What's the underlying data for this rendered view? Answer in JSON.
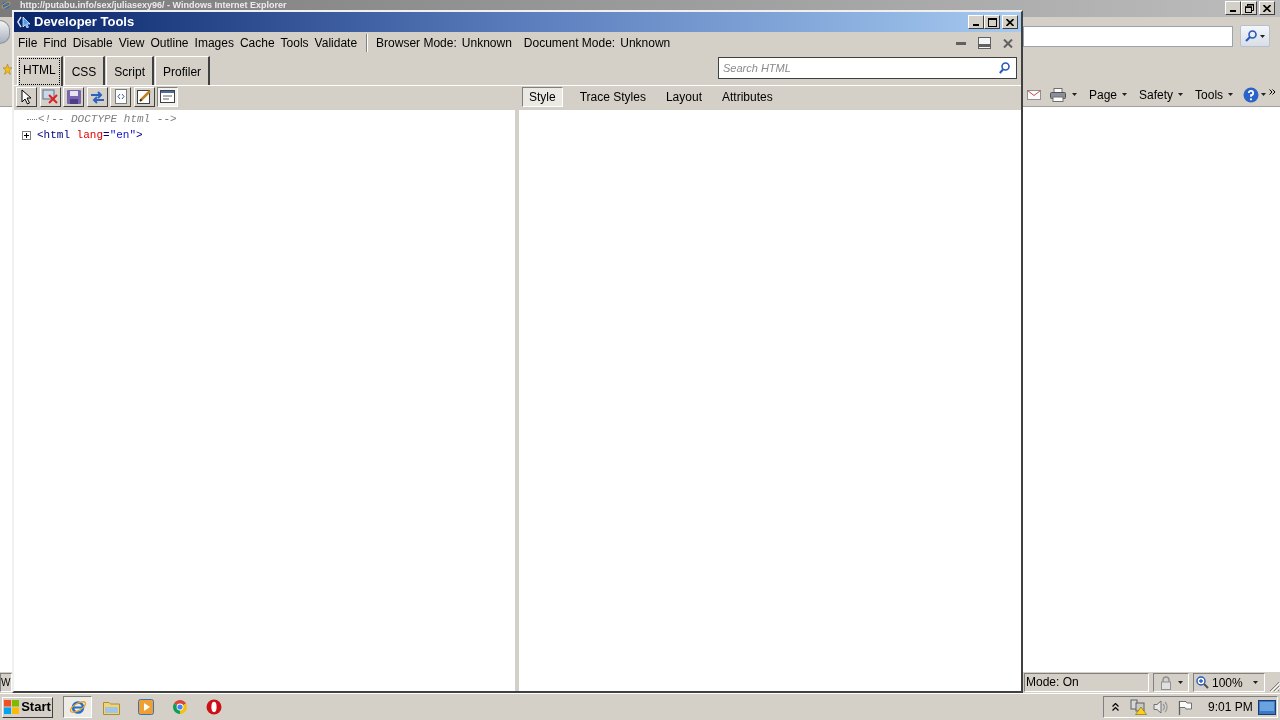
{
  "browser": {
    "title": "http://putabu.info/sex/juliasexy96/ - Windows Internet Explorer",
    "command_menus": [
      "Page",
      "Safety",
      "Tools"
    ],
    "status_bar": {
      "text": "W",
      "mode": "Mode: On",
      "zoom": "100%"
    }
  },
  "devtools": {
    "title": "Developer Tools",
    "menu": [
      "File",
      "Find",
      "Disable",
      "View",
      "Outline",
      "Images",
      "Cache",
      "Tools",
      "Validate"
    ],
    "modes": [
      {
        "label": "Browser Mode:",
        "value": "Unknown"
      },
      {
        "label": "Document Mode:",
        "value": "Unknown"
      }
    ],
    "tabs": [
      {
        "label": "HTML",
        "selected": true
      },
      {
        "label": "CSS",
        "selected": false
      },
      {
        "label": "Script",
        "selected": false
      },
      {
        "label": "Profiler",
        "selected": false
      }
    ],
    "search": {
      "placeholder": "Search HTML"
    },
    "toolbar": [
      {
        "kind": "select",
        "pressed": false
      },
      {
        "kind": "clear",
        "pressed": false
      },
      {
        "kind": "save",
        "pressed": false
      },
      {
        "kind": "refresh",
        "pressed": false
      },
      {
        "kind": "source",
        "pressed": false
      },
      {
        "kind": "edit",
        "pressed": false
      },
      {
        "kind": "wrap",
        "pressed": true
      }
    ],
    "side_tabs": [
      {
        "label": "Style",
        "selected": true
      },
      {
        "label": "Trace Styles",
        "selected": false
      },
      {
        "label": "Layout",
        "selected": false
      },
      {
        "label": "Attributes",
        "selected": false
      }
    ],
    "tree": [
      {
        "kind": "comment",
        "text": "<!-- DOCTYPE html -->"
      },
      {
        "kind": "element",
        "expanded": false,
        "tokens": [
          {
            "kind": "tag",
            "text": "<html"
          },
          {
            "kind": "attr_name",
            "text": " lang"
          },
          {
            "kind": "punct",
            "text": "="
          },
          {
            "kind": "attr_value",
            "text": "\"en\""
          },
          {
            "kind": "tag",
            "text": ">"
          }
        ]
      }
    ]
  },
  "taskbar": {
    "start": "Start",
    "apps": [
      {
        "kind": "browser",
        "active": true
      },
      {
        "kind": "folder",
        "active": false
      },
      {
        "kind": "media",
        "active": false
      },
      {
        "kind": "round",
        "active": false
      },
      {
        "kind": "ring",
        "active": false
      }
    ],
    "clock": "9:01 PM"
  }
}
